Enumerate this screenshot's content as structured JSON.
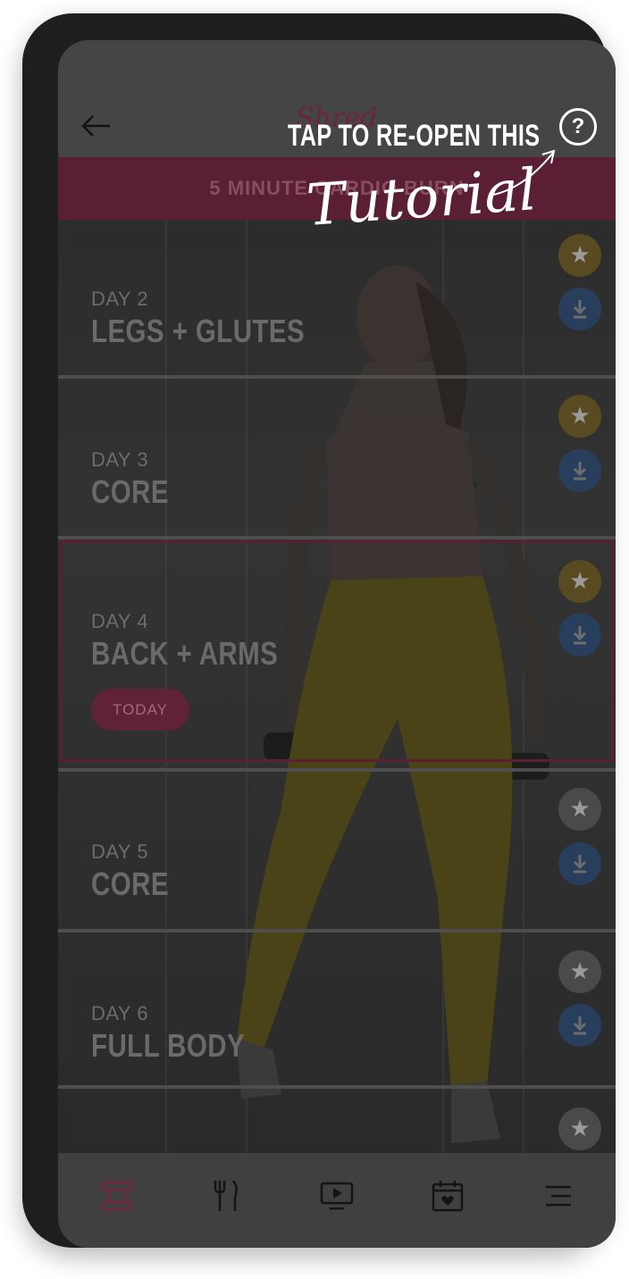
{
  "header": {
    "logo_text": "Shred",
    "help_symbol": "?",
    "back_icon": "arrow-left-icon",
    "help_icon": "help-circle-icon"
  },
  "banner": {
    "title": "5 MINUTE CARDIO BURN"
  },
  "days": [
    {
      "day_label": "DAY 2",
      "title": "LEGS + GLUTES",
      "favorited": true
    },
    {
      "day_label": "DAY 3",
      "title": "CORE",
      "favorited": true
    },
    {
      "day_label": "DAY 4",
      "title": "BACK + ARMS",
      "favorited": true,
      "today_label": "TODAY"
    },
    {
      "day_label": "DAY 5",
      "title": "CORE",
      "favorited": false
    },
    {
      "day_label": "DAY 6",
      "title": "FULL BODY",
      "favorited": false
    }
  ],
  "tutorial": {
    "caption": "TAP TO RE-OPEN THIS",
    "word": "Tutorial"
  },
  "tabbar": {
    "items": [
      {
        "icon": "dumbbell-icon",
        "active": true
      },
      {
        "icon": "fork-knife-icon",
        "active": false
      },
      {
        "icon": "video-play-icon",
        "active": false
      },
      {
        "icon": "calendar-heart-icon",
        "active": false
      },
      {
        "icon": "menu-icon",
        "active": false
      }
    ]
  },
  "colors": {
    "accent_pink": "#e03a6a",
    "star_gold": "#f2b21d",
    "download_blue": "#3d7fc9",
    "overlay": "rgba(0,0,0,0.75)"
  }
}
